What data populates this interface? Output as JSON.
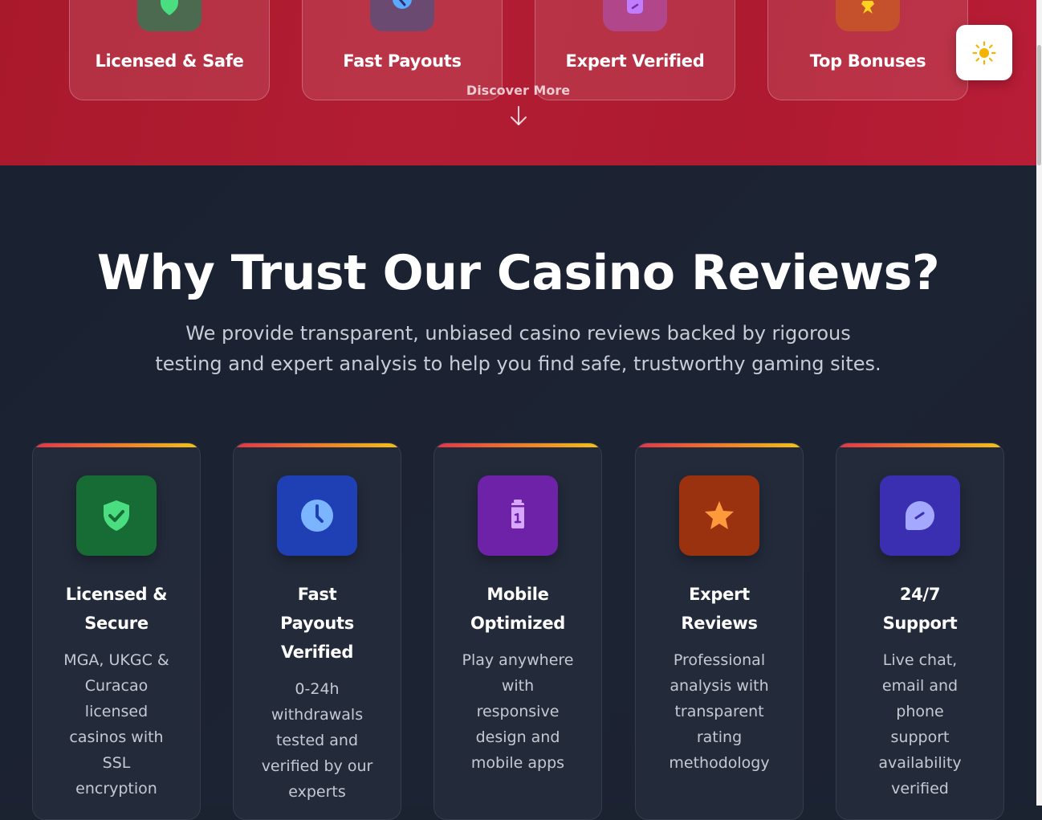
{
  "hero": {
    "cards": [
      {
        "label": "Licensed & Safe",
        "icon": "shield-check-icon",
        "icon_bg": "#4a6b4d",
        "icon_color": "#4ade80"
      },
      {
        "label": "Fast Payouts",
        "icon": "clock-icon",
        "icon_bg": "#6b4770",
        "icon_color": "#5aa8ff"
      },
      {
        "label": "Expert Verified",
        "icon": "badge-icon",
        "icon_bg": "#b0458c",
        "icon_color": "#c07dff"
      },
      {
        "label": "Top Bonuses",
        "icon": "star-icon",
        "icon_bg": "#c4512a",
        "icon_color": "#ffd21f"
      }
    ],
    "discover_label": "Discover More",
    "background": "#b01c31"
  },
  "theme_toggle": {
    "icon": "sun-icon",
    "color": "#f5b301"
  },
  "trust": {
    "title": "Why Trust Our Casino Reviews?",
    "subtitle": "We provide transparent, unbiased casino reviews backed by rigorous testing and expert analysis to help you find safe, trustworthy gaming sites.",
    "features": [
      {
        "title": "Licensed & Secure",
        "title_lines": [
          "Licensed &",
          "Secure"
        ],
        "description": "MGA, UKGC & Curacao licensed casinos with SSL encryption",
        "desc_lines": [
          "MGA, UKGC &",
          "Curacao",
          "licensed",
          "casinos with",
          "SSL",
          "encryption"
        ],
        "icon": "shield-check-icon",
        "icon_bg": "#176b34",
        "icon_color": "#4ade80"
      },
      {
        "title": "Fast Payouts Verified",
        "title_lines": [
          "Fast",
          "Payouts",
          "Verified"
        ],
        "description": "0-24h withdrawals tested and verified by our experts",
        "desc_lines": [
          "0-24h",
          "withdrawals",
          "tested and",
          "verified by our",
          "experts"
        ],
        "icon": "clock-icon",
        "icon_bg": "#1f3fb5",
        "icon_color": "#7cb5ff"
      },
      {
        "title": "Mobile Optimized",
        "title_lines": [
          "Mobile",
          "Optimized"
        ],
        "description": "Play anywhere with responsive design and mobile apps",
        "desc_lines": [
          "Play anywhere",
          "with",
          "responsive",
          "design and",
          "mobile apps"
        ],
        "icon": "mobile-phone-icon",
        "icon_bg": "#6d22a8",
        "icon_color": "#d8a8ff"
      },
      {
        "title": "Expert Reviews",
        "title_lines": [
          "Expert",
          "Reviews"
        ],
        "description": "Professional analysis with transparent rating methodology",
        "desc_lines": [
          "Professional",
          "analysis with",
          "transparent",
          "rating",
          "methodology"
        ],
        "icon": "star-icon",
        "icon_bg": "#9a3210",
        "icon_color": "#ff9a3c"
      },
      {
        "title": "24/7 Support",
        "title_lines": [
          "24/7",
          "Support"
        ],
        "description": "Live chat, email and phone support availability verified",
        "desc_lines": [
          "Live chat,",
          "email and",
          "phone",
          "support",
          "availability",
          "verified"
        ],
        "icon": "support-chat-icon",
        "icon_bg": "#3a2fb0",
        "icon_color": "#a5a8ff"
      }
    ]
  }
}
